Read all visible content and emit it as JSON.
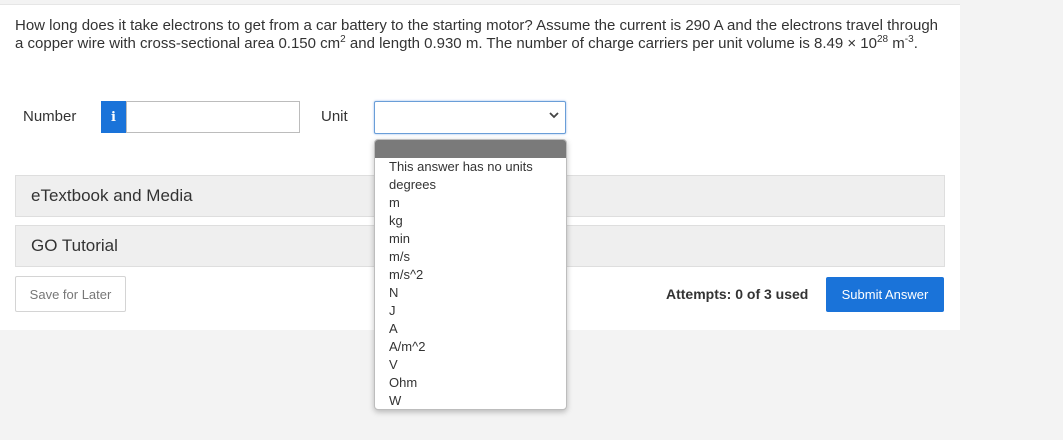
{
  "question": {
    "part1": "How long does it take electrons to get from a car battery to the starting motor? Assume the current is 290 A and the electrons travel through a copper wire with cross-sectional area 0.150 cm",
    "sup1": "2",
    "part2": " and length 0.930 m. The number of charge carriers per unit volume is 8.49 × 10",
    "sup2": "28",
    "part3": " m",
    "sup3": "-3",
    "part4": "."
  },
  "form": {
    "number_label": "Number",
    "info_icon": "i",
    "unit_label": "Unit",
    "unit_selected": "",
    "unit_options": [
      "This answer has no units",
      "degrees",
      "m",
      "kg",
      "min",
      "m/s",
      "m/s^2",
      "N",
      "J",
      "A",
      "A/m^2",
      "V",
      "Ohm",
      "W"
    ]
  },
  "panels": {
    "etextbook": "eTextbook and Media",
    "go_tutorial": "GO Tutorial"
  },
  "footer": {
    "save_label": "Save for Later",
    "attempts": "Attempts: 0 of 3 used",
    "submit_label": "Submit Answer"
  },
  "colors": {
    "accent": "#1a73d9"
  }
}
